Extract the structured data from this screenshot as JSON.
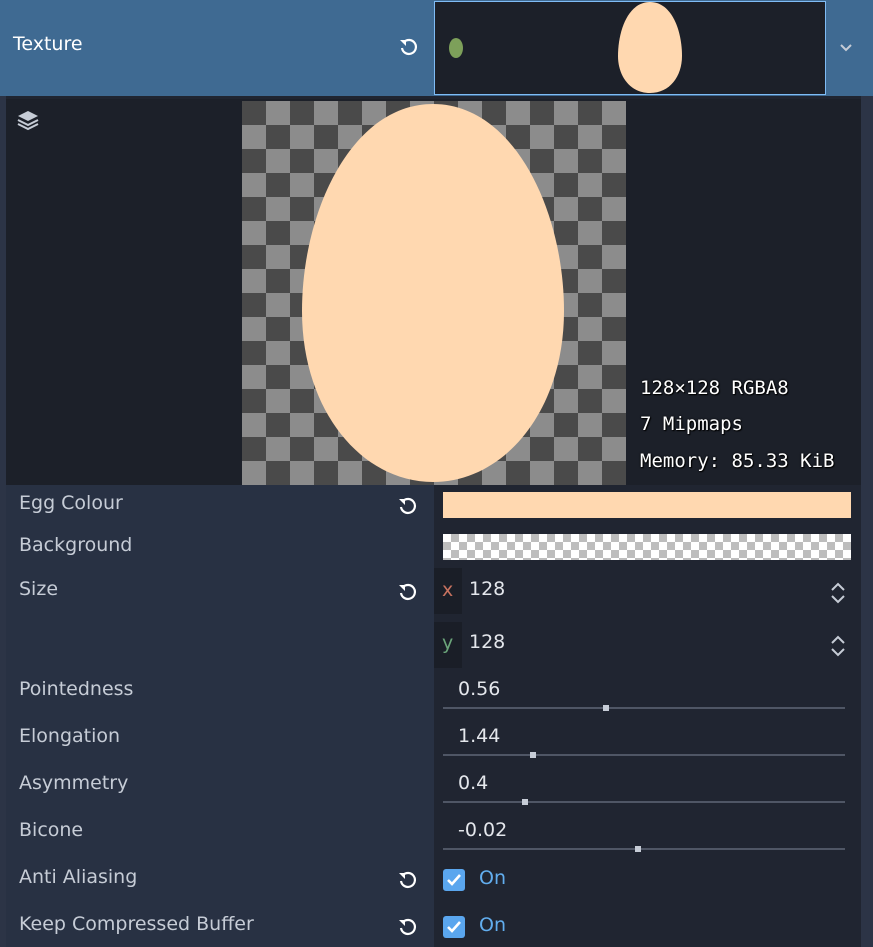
{
  "texture": {
    "label": "Texture",
    "revert_icon": "revert-icon",
    "dropdown_icon": "chevron-down-icon",
    "preview_info": {
      "dimensions": "128×128 RGBA8",
      "mipmaps": "7 Mipmaps",
      "memory": "Memory: 85.33 KiB"
    },
    "egg_color": "#ffd8b0",
    "thumb_dot_color": "#7da05a"
  },
  "properties": {
    "egg_colour": {
      "label": "Egg Colour",
      "value": "#ffd8b0"
    },
    "background": {
      "label": "Background"
    },
    "size": {
      "label": "Size",
      "x_label": "x",
      "x_value": "128",
      "y_label": "y",
      "y_value": "128"
    },
    "pointedness": {
      "label": "Pointedness",
      "value": "0.56",
      "fraction": 0.405
    },
    "elongation": {
      "label": "Elongation",
      "value": "1.44",
      "fraction": 0.225
    },
    "asymmetry": {
      "label": "Asymmetry",
      "value": "0.4",
      "fraction": 0.205
    },
    "bicone": {
      "label": "Bicone",
      "value": "-0.02",
      "fraction": 0.485
    },
    "anti_aliasing": {
      "label": "Anti Aliasing",
      "checked": true,
      "state": "On"
    },
    "keep_compressed_buffer": {
      "label": "Keep Compressed Buffer",
      "checked": true,
      "state": "On"
    }
  },
  "colors": {
    "accent": "#5aa6ee",
    "header_bg": "#3f6a92",
    "x_axis": "#c7725f",
    "y_axis": "#6ba57a"
  }
}
